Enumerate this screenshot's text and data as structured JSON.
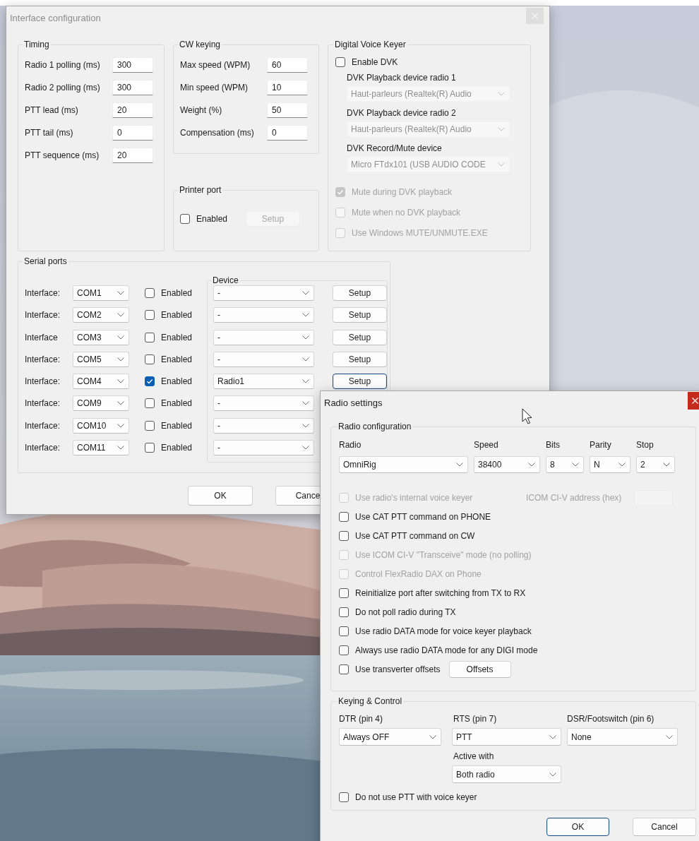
{
  "interface_window": {
    "title": "Interface configuration",
    "active": false,
    "timing": {
      "title": "Timing",
      "fields": [
        {
          "label": "Radio 1 polling (ms)",
          "value": "300"
        },
        {
          "label": "Radio 2 polling (ms)",
          "value": "300"
        },
        {
          "label": "PTT lead (ms)",
          "value": "20"
        },
        {
          "label": "PTT tail (ms)",
          "value": "0"
        },
        {
          "label": "PTT sequence (ms)",
          "value": "20"
        }
      ]
    },
    "cw_keying": {
      "title": "CW keying",
      "fields": [
        {
          "label": "Max speed (WPM)",
          "value": "60"
        },
        {
          "label": "Min speed (WPM)",
          "value": "10"
        },
        {
          "label": "Weight (%)",
          "value": "50"
        },
        {
          "label": "Compensation (ms)",
          "value": "0"
        }
      ]
    },
    "printer_port": {
      "title": "Printer port",
      "enabled": {
        "label": "Enabled",
        "checked": false
      },
      "setup_button": {
        "label": "Setup",
        "disabled": true
      }
    },
    "digital_voice_keyer": {
      "title": "Digital Voice Keyer",
      "enable": {
        "label": "Enable DVK",
        "checked": false
      },
      "devices": [
        {
          "label": "DVK Playback device radio 1",
          "value": "Haut-parleurs (Realtek(R) Audio",
          "disabled": true
        },
        {
          "label": "DVK Playback device radio 2",
          "value": "Haut-parleurs (Realtek(R) Audio",
          "disabled": true
        },
        {
          "label": "DVK Record/Mute device",
          "value": "Micro FTdx101 (USB AUDIO CODE",
          "disabled": true
        }
      ],
      "options": [
        {
          "label": "Mute during DVK playback",
          "checked": true,
          "disabled": true
        },
        {
          "label": "Mute when no DVK playback",
          "checked": false,
          "disabled": true
        },
        {
          "label": "Use Windows MUTE/UNMUTE.EXE",
          "checked": false,
          "disabled": true
        }
      ]
    },
    "serial_ports": {
      "title": "Serial ports",
      "device_title": "Device",
      "rows": [
        {
          "label": "Interface:",
          "port": "COM1",
          "enabled_label": "Enabled",
          "enabled": false,
          "device": "-",
          "setup_label": "Setup",
          "setup_focused": false
        },
        {
          "label": "Interface:",
          "port": "COM2",
          "enabled_label": "Enabled",
          "enabled": false,
          "device": "-",
          "setup_label": "Setup",
          "setup_focused": false
        },
        {
          "label": "Interface",
          "port": "COM3",
          "enabled_label": "Enabled",
          "enabled": false,
          "device": "-",
          "setup_label": "Setup",
          "setup_focused": false
        },
        {
          "label": "Interface:",
          "port": "COM5",
          "enabled_label": "Enabled",
          "enabled": false,
          "device": "-",
          "setup_label": "Setup",
          "setup_focused": false
        },
        {
          "label": "Interface:",
          "port": "COM4",
          "enabled_label": "Enabled",
          "enabled": true,
          "device": "Radio1",
          "setup_label": "Setup",
          "setup_focused": true
        },
        {
          "label": "Interface:",
          "port": "COM9",
          "enabled_label": "Enabled",
          "enabled": false,
          "device": "-"
        },
        {
          "label": "Interface:",
          "port": "COM10",
          "enabled_label": "Enabled",
          "enabled": false,
          "device": "-"
        },
        {
          "label": "Interface:",
          "port": "COM11",
          "enabled_label": "Enabled",
          "enabled": false,
          "device": "-"
        }
      ]
    },
    "buttons": [
      {
        "label": "OK",
        "focused": false
      },
      {
        "label": "Cance",
        "focused": false
      }
    ]
  },
  "radio_window": {
    "title": "Radio settings",
    "active": true,
    "radio_configuration": {
      "title": "Radio configuration",
      "settings": [
        {
          "label": "Radio",
          "value": "OmniRig"
        },
        {
          "label": "Speed",
          "value": "38400"
        },
        {
          "label": "Bits",
          "value": "8"
        },
        {
          "label": "Parity",
          "value": "N"
        },
        {
          "label": "Stop",
          "value": "2"
        }
      ],
      "options": [
        {
          "label": "Use radio's internal voice keyer",
          "checked": false,
          "disabled": true,
          "address": {
            "label": "ICOM CI-V address (hex)",
            "disabled": true
          }
        },
        {
          "label": "Use CAT PTT command on PHONE",
          "checked": false,
          "disabled": false
        },
        {
          "label": "Use CAT PTT command on CW",
          "checked": false,
          "disabled": false
        },
        {
          "label": "Use ICOM CI-V \"Transceive\" mode (no polling)",
          "checked": false,
          "disabled": true
        },
        {
          "label": "Control FlexRadio DAX on Phone",
          "checked": false,
          "disabled": true
        },
        {
          "label": "Reinitialize port after switching from TX to RX",
          "checked": false,
          "disabled": false
        },
        {
          "label": "Do not poll radio during TX",
          "checked": false,
          "disabled": false
        },
        {
          "label": "Use radio DATA mode for voice keyer playback",
          "checked": false,
          "disabled": false
        },
        {
          "label": "Always use radio DATA mode for any DIGI mode",
          "checked": false,
          "disabled": false
        },
        {
          "label": "Use transverter offsets",
          "checked": false,
          "disabled": false,
          "button": "Offsets"
        }
      ]
    },
    "keying_control": {
      "title": "Keying & Control",
      "dtr": {
        "label": "DTR (pin 4)",
        "value": "Always OFF"
      },
      "rts": {
        "label": "RTS (pin 7)",
        "value": "PTT"
      },
      "dsr": {
        "label": "DSR/Footswitch (pin 6)",
        "value": "None"
      },
      "active_with": {
        "label": "Active with",
        "value": "Both radio"
      },
      "no_ptt": {
        "label": "Do not use PTT with voice keyer",
        "checked": false
      }
    },
    "buttons": [
      {
        "label": "OK",
        "focused": true
      },
      {
        "label": "Cancel",
        "focused": false
      }
    ]
  }
}
